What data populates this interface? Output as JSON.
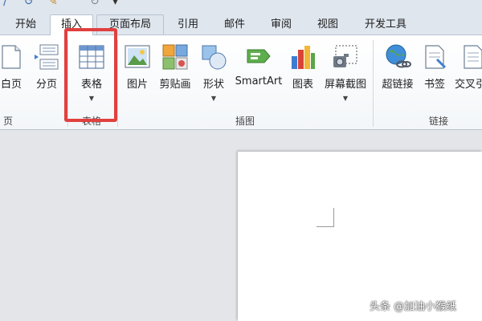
{
  "tabs": [
    {
      "label": "开始"
    },
    {
      "label": "插入"
    },
    {
      "label": "页面布局"
    },
    {
      "label": "引用"
    },
    {
      "label": "邮件"
    },
    {
      "label": "审阅"
    },
    {
      "label": "视图"
    },
    {
      "label": "开发工具"
    }
  ],
  "ribbon": {
    "pages": {
      "blank_page": "白页",
      "page_break": "分页",
      "group_label": "页"
    },
    "tables": {
      "table": "表格",
      "group_label": "表格"
    },
    "illustrations": {
      "picture": "图片",
      "clip_art": "剪贴画",
      "shapes": "形状",
      "smartart": "SmartArt",
      "chart": "图表",
      "screenshot": "屏幕截图",
      "group_label": "插图"
    },
    "links": {
      "hyperlink": "超链接",
      "bookmark": "书签",
      "cross_reference": "交叉引",
      "group_label": "链接"
    }
  },
  "watermark": "头条 @加油小猴纸",
  "colors": {
    "highlight": "#e0403f",
    "tab_bar": "#dfe6ee",
    "document_background": "#e3e5e8"
  }
}
